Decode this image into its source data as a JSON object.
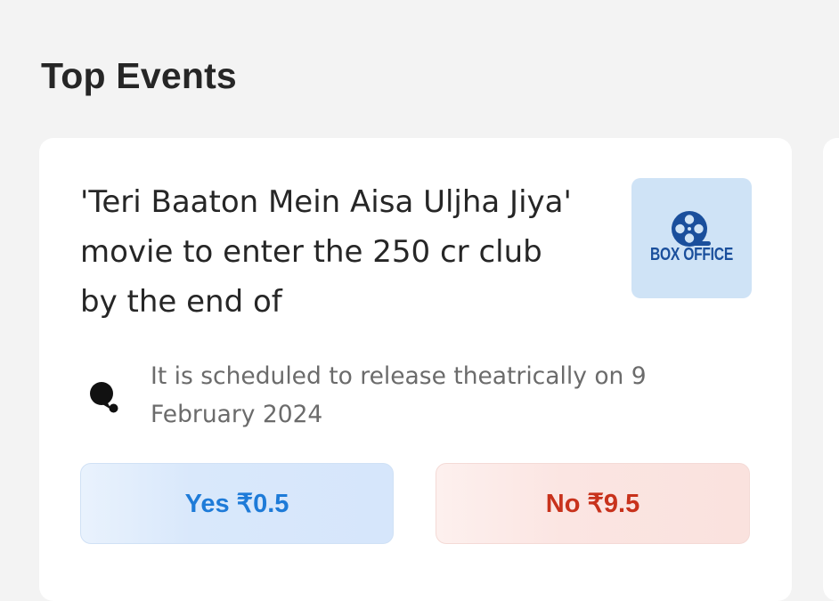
{
  "section": {
    "title": "Top Events"
  },
  "event": {
    "title": "'Teri Baaton Mein Aisa Uljha Jiya' movie to enter the 250 cr club by the end of",
    "thumbnail_label": "BOX OFFICE",
    "thumbnail_icon": "film-reel-icon",
    "source_icon": "source-logo-icon",
    "description": "It is scheduled to release theatrically on 9 February 2024",
    "yes_label": "Yes ₹0.5",
    "no_label": "No ₹9.5"
  },
  "colors": {
    "page_bg": "#f3f3f3",
    "card_bg": "#ffffff",
    "yes_text": "#1e7bd8",
    "yes_bg": "#d9e8fb",
    "no_text": "#c8321c",
    "no_bg": "#fbe5e2",
    "thumb_bg": "#cfe3f6",
    "thumb_text": "#1a4f9c"
  }
}
